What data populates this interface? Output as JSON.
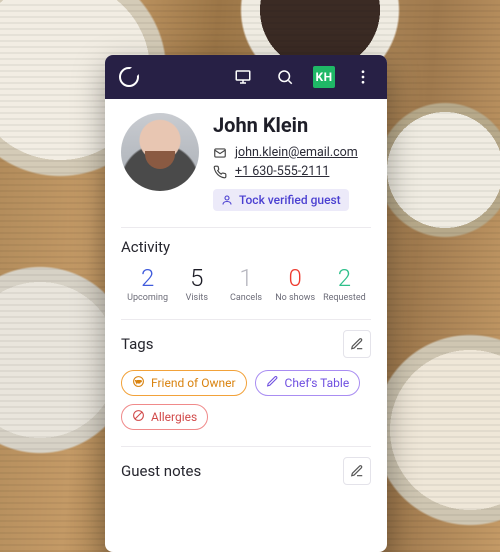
{
  "topbar": {
    "module_badge": "KH"
  },
  "profile": {
    "name": "John Klein",
    "email": "john.klein@email.com",
    "phone": "+1 630-555-2111",
    "verified_label": "Tock verified guest"
  },
  "activity": {
    "title": "Activity",
    "stats": [
      {
        "value": "2",
        "label": "Upcoming",
        "color": "c-blue"
      },
      {
        "value": "5",
        "label": "Visits",
        "color": "c-black"
      },
      {
        "value": "1",
        "label": "Cancels",
        "color": "c-gray"
      },
      {
        "value": "0",
        "label": "No shows",
        "color": "c-red"
      },
      {
        "value": "2",
        "label": "Requested",
        "color": "c-green"
      }
    ]
  },
  "tags": {
    "title": "Tags",
    "items": [
      {
        "label": "Friend of Owner",
        "icon": "vip",
        "style": "tag-orange"
      },
      {
        "label": "Chef's Table",
        "icon": "pencil",
        "style": "tag-purple"
      },
      {
        "label": "Allergies",
        "icon": "no",
        "style": "tag-red"
      }
    ]
  },
  "notes": {
    "title": "Guest notes"
  }
}
